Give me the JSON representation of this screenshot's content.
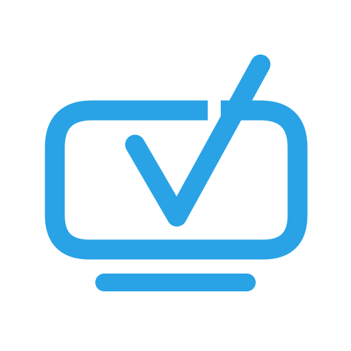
{
  "icon": {
    "name": "monitor-checkmark-icon",
    "description_tag": "monitor-with-checkmark"
  },
  "colors": {
    "background": "#ffffff",
    "accent": "#29a3e6"
  }
}
